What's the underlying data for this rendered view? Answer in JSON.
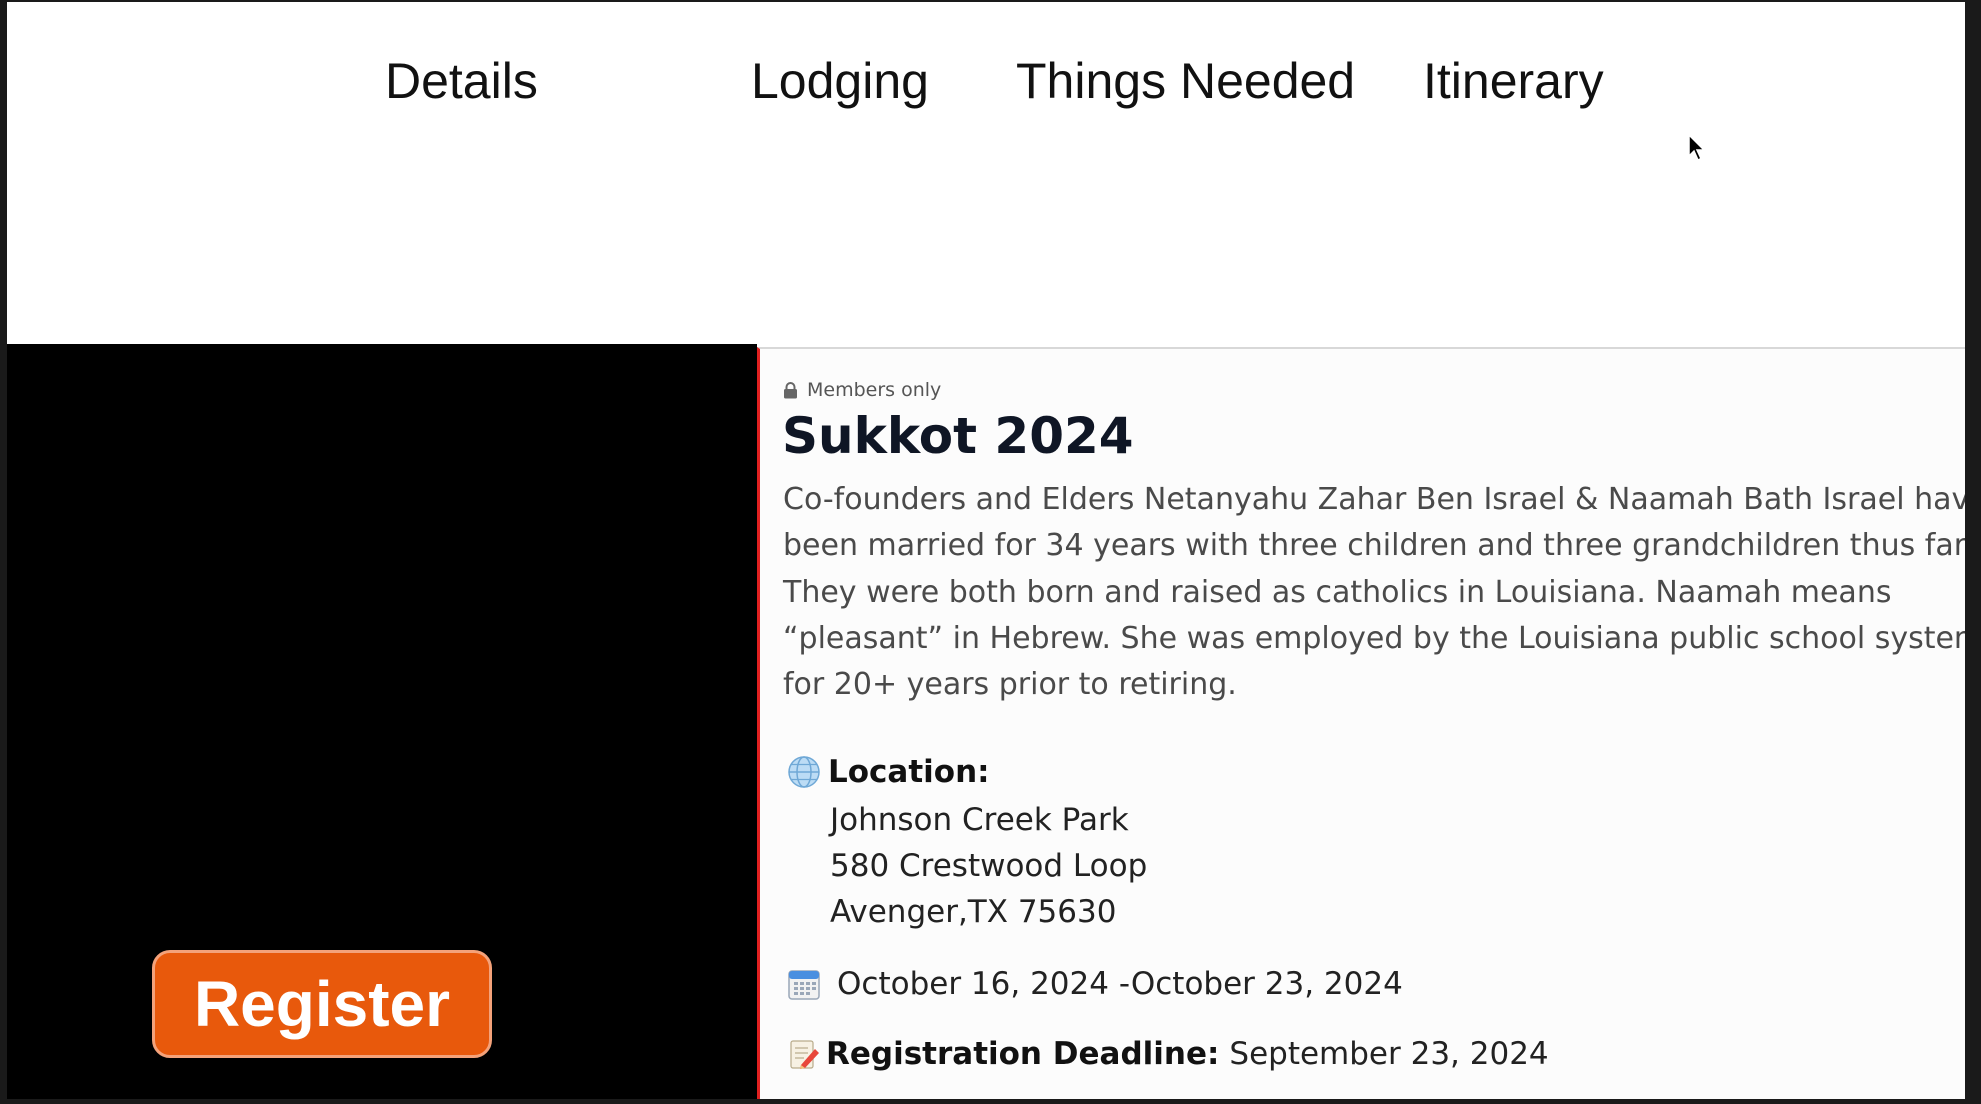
{
  "nav": {
    "items": [
      {
        "label": "Details"
      },
      {
        "label": "Lodging"
      },
      {
        "label": "Things Needed"
      },
      {
        "label": "Itinerary"
      }
    ]
  },
  "sidebar": {
    "register_label": "Register",
    "register_color": "#e8590c"
  },
  "event": {
    "visibility_label": "Members only",
    "title": "Sukkot 2024",
    "description": "Co-founders and Elders Netanyahu Zahar Ben Israel & Naamah Bath Israel have been married for 34 years with three children and three grandchildren thus far. They were both born and raised as catholics in Louisiana. Naamah means “pleasant” in Hebrew. She was employed by the Louisiana public school system for 20+ years prior to retiring.",
    "location": {
      "icon": "globe-icon",
      "label": "Location:",
      "name": "Johnson Creek Park",
      "street": "580 Crestwood Loop",
      "city_line": "Avenger,TX 75630"
    },
    "dates": {
      "icon": "calendar-icon",
      "text": "October 16, 2024 -October 23, 2024"
    },
    "deadline": {
      "icon": "memo-icon",
      "label": "Registration Deadline:",
      "value": "September 23, 2024"
    }
  }
}
